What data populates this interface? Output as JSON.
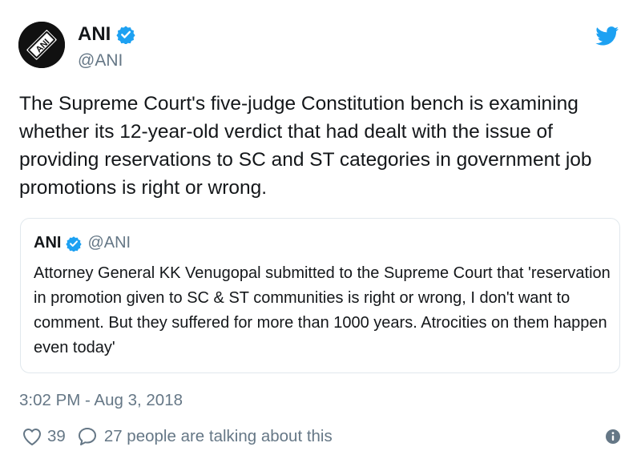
{
  "author": {
    "name": "ANI",
    "handle": "@ANI",
    "avatar_text": "ANI",
    "verified_icon": "verified-badge-icon"
  },
  "tweet": {
    "text": "The Supreme Court's five-judge Constitution bench is examining whether its 12-year-old verdict that had dealt with the issue of providing reservations to SC and ST categories in government job promotions is right or wrong."
  },
  "quoted_tweet": {
    "name": "ANI",
    "handle": "@ANI",
    "text": "Attorney General KK Venugopal submitted to the Supreme Court that 'reservation in promotion given to SC &  ST communities is right or wrong, I don't want to comment. But they suffered for more than 1000 years. Atrocities on them happen even today'"
  },
  "timestamp": "3:02 PM - Aug 3, 2018",
  "actions": {
    "likes": "39",
    "talking": "27 people are talking about this"
  },
  "colors": {
    "twitter_blue": "#1da1f2",
    "text": "#14171a",
    "secondary_text": "#657786",
    "border": "#e1e8ed"
  },
  "icons": [
    "twitter-bird-icon",
    "verified-badge-icon",
    "heart-icon",
    "comment-bubble-icon",
    "info-icon"
  ]
}
